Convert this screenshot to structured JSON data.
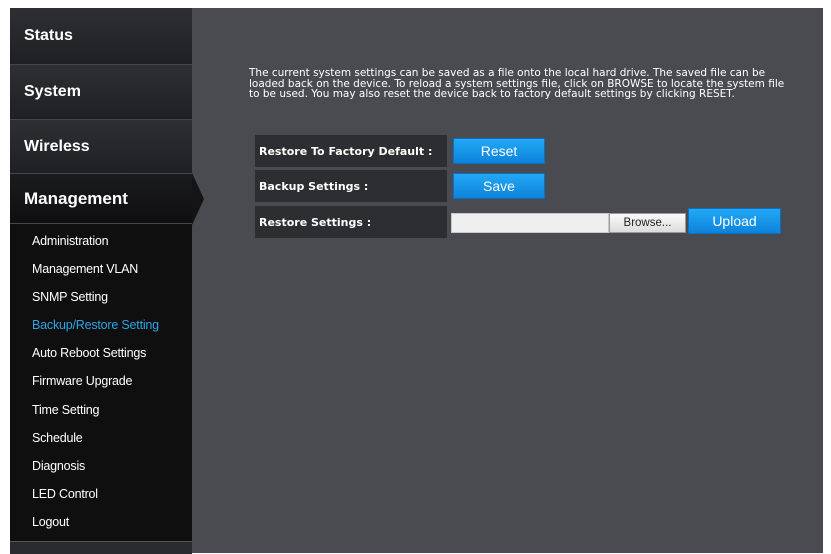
{
  "sidebar": {
    "tabs": [
      {
        "label": "Status"
      },
      {
        "label": "System"
      },
      {
        "label": "Wireless"
      },
      {
        "label": "Management"
      }
    ],
    "submenu": [
      {
        "label": "Administration"
      },
      {
        "label": "Management VLAN"
      },
      {
        "label": "SNMP Setting"
      },
      {
        "label": "Backup/Restore Setting"
      },
      {
        "label": "Auto Reboot Settings"
      },
      {
        "label": "Firmware Upgrade"
      },
      {
        "label": "Time Setting"
      },
      {
        "label": "Schedule"
      },
      {
        "label": "Diagnosis"
      },
      {
        "label": "LED Control"
      },
      {
        "label": "Logout"
      }
    ],
    "active_submenu_color": "#2fa3e6"
  },
  "content": {
    "description": "The current system settings can be saved as a file onto the local hard drive. The saved file can be loaded back on the device. To reload a system settings file, click on BROWSE to locate the system file to be used. You may also reset the device back to factory default settings by clicking RESET.",
    "rows": [
      {
        "label": "Restore To Factory Default :",
        "button": "Reset"
      },
      {
        "label": "Backup Settings :",
        "button": "Save"
      },
      {
        "label": "Restore Settings :",
        "file_value": "",
        "browse_label": "Browse...",
        "button": "Upload"
      }
    ]
  },
  "colors": {
    "background": "#4a4b50",
    "button": "#1596e6"
  }
}
